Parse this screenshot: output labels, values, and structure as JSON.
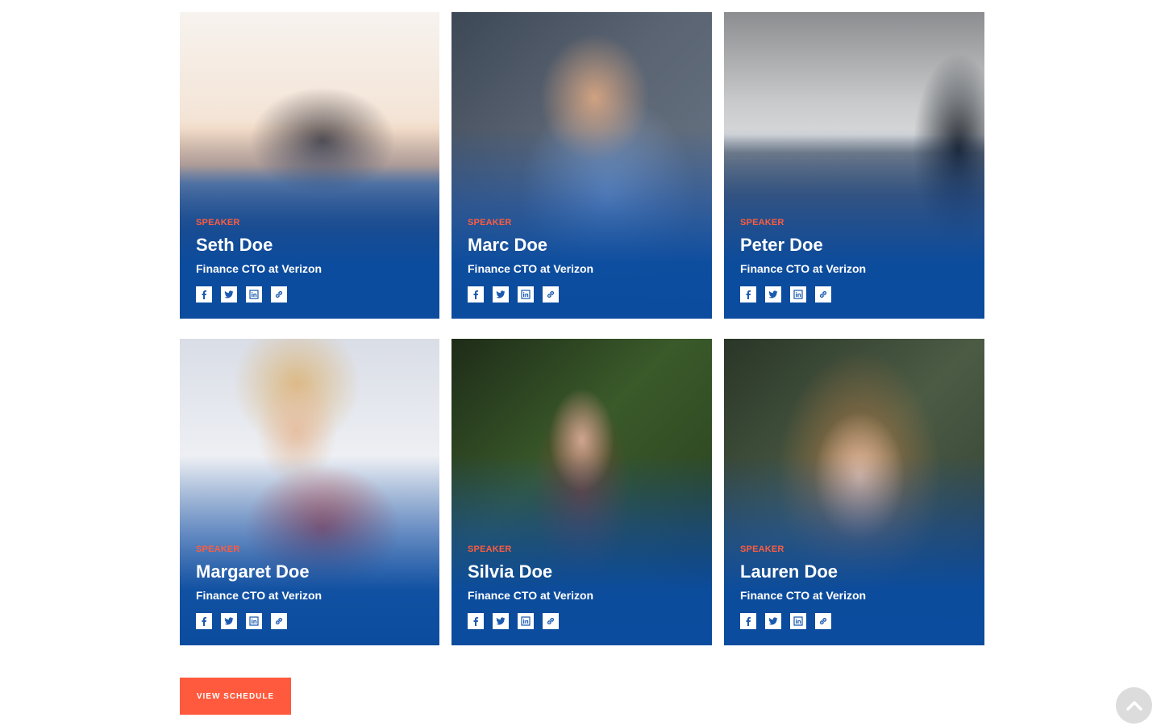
{
  "speakers": [
    {
      "role": "SPEAKER",
      "name": "Seth Doe",
      "title": "Finance CTO at Verizon"
    },
    {
      "role": "SPEAKER",
      "name": "Marc Doe",
      "title": "Finance CTO at Verizon"
    },
    {
      "role": "SPEAKER",
      "name": "Peter Doe",
      "title": "Finance CTO at Verizon"
    },
    {
      "role": "SPEAKER",
      "name": "Margaret Doe",
      "title": "Finance CTO at Verizon"
    },
    {
      "role": "SPEAKER",
      "name": "Silvia Doe",
      "title": "Finance CTO at Verizon"
    },
    {
      "role": "SPEAKER",
      "name": "Lauren Doe",
      "title": "Finance CTO at Verizon"
    }
  ],
  "social_icons": [
    "facebook-icon",
    "twitter-icon",
    "linkedin-icon",
    "link-icon"
  ],
  "view_schedule_label": "VIEW SCHEDULE",
  "scroll_top_icon": "chevron-up-icon",
  "colors": {
    "accent": "#ff5a3d",
    "overlay_blue": "#0b4c9f",
    "icon_blue": "#1a5bb0"
  }
}
